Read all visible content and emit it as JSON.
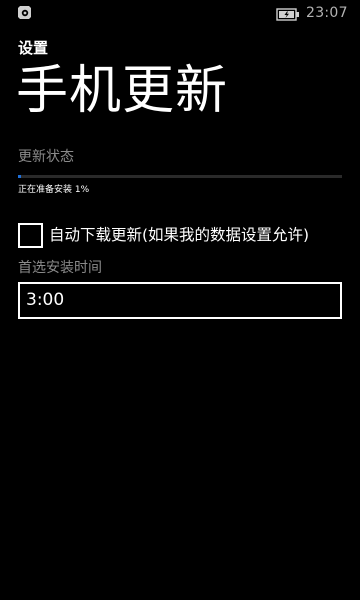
{
  "status_bar": {
    "left_icon": "notification-icon",
    "battery_icon": "battery-charging-icon",
    "time": "23:07"
  },
  "header": {
    "app_title": "设置",
    "page_title": "手机更新"
  },
  "update_status": {
    "label": "更新状态",
    "progress_text": "正在准备安装 1%",
    "progress_fraction": 0.01,
    "progress_color": "#1e6fd9"
  },
  "auto_download": {
    "label": "自动下载更新(如果我的数据设置允许)",
    "checked": false
  },
  "install_time": {
    "label": "首选安装时间",
    "value": "3:00"
  }
}
